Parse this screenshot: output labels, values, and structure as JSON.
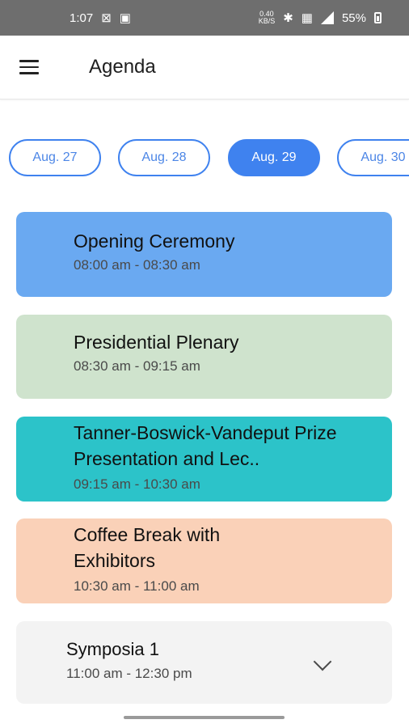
{
  "status_bar": {
    "time": "1:07",
    "battery": "55%",
    "icons": [
      "signal-icon",
      "image-icon",
      "data-speed-icon",
      "bluetooth-icon",
      "nfc-icon",
      "cell-signal-icon",
      "battery-icon"
    ],
    "speed": "0.40\nKB/S"
  },
  "app_bar": {
    "title": "Agenda"
  },
  "dates": [
    {
      "label": "Aug. 27",
      "active": false
    },
    {
      "label": "Aug. 28",
      "active": false
    },
    {
      "label": "Aug. 29",
      "active": true
    },
    {
      "label": "Aug. 30",
      "active": false
    }
  ],
  "sessions": [
    {
      "title": "Opening Ceremony",
      "time": "08:00 am  - 08:30 am",
      "color": "#6aa9f1"
    },
    {
      "title": "Presidential Plenary",
      "time": "08:30 am  - 09:15 am",
      "color": "#cfe3cd"
    },
    {
      "title": "Tanner-Boswick-Vandeput Prize Presentation and Lec..",
      "time": "09:15 am  - 10:30 am",
      "color": "#2cc3c9"
    },
    {
      "title": "Coffee Break with Exhibitors",
      "time": "10:30 am  - 11:00 am",
      "color": "#fad1b8"
    },
    {
      "title": "Symposia 1",
      "time": "11:00 am  - 12:30 pm",
      "color": "#f3f3f3"
    }
  ],
  "colors": {
    "accent": "#3f82ef"
  }
}
